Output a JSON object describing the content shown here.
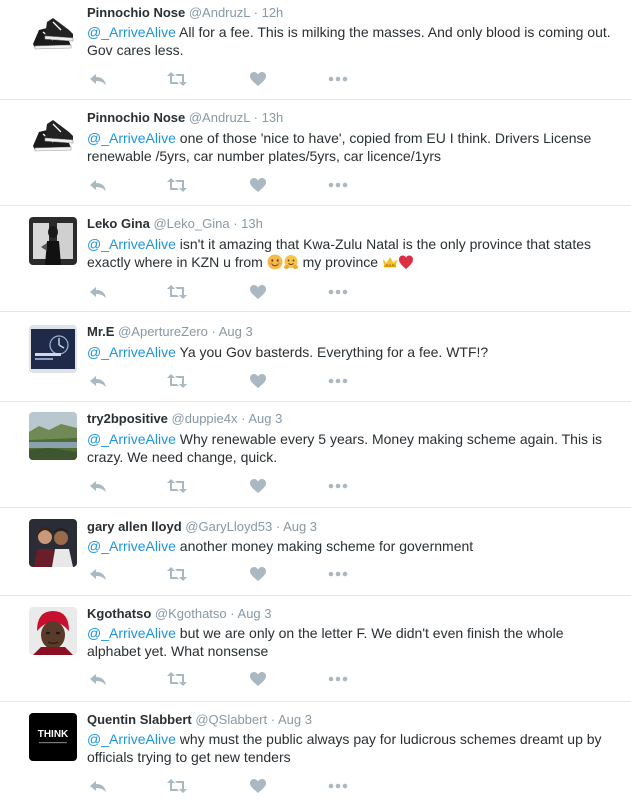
{
  "colors": {
    "mention": "#1b95e0",
    "meta": "#8899a6",
    "icon": "#aab8c2",
    "text": "#292f33",
    "divider": "#e1e8ed",
    "heart": "#e0245e"
  },
  "icons": {
    "reply": "reply-icon",
    "retweet": "retweet-icon",
    "like": "heart-icon",
    "more": "more-dots-icon"
  },
  "tweets": [
    {
      "name": "Pinnochio Nose",
      "handle": "@AndruzL",
      "sep": "·",
      "time": "12h",
      "mention": "@_ArriveAlive",
      "text": " All for a fee. This is milking the masses. And only blood is coming out. Gov cares less.",
      "avatar": "sneakers"
    },
    {
      "name": "Pinnochio Nose",
      "handle": "@AndruzL",
      "sep": "·",
      "time": "13h",
      "mention": "@_ArriveAlive",
      "text": " one of those 'nice to have', copied from EU I think. Drivers License renewable /5yrs, car number plates/5yrs, car licence/1yrs",
      "avatar": "sneakers"
    },
    {
      "name": "Leko Gina",
      "handle": "@Leko_Gina",
      "sep": "·",
      "time": "13h",
      "mention": "@_ArriveAlive",
      "text_a": "  isn't it amazing that Kwa-Zulu Natal is the only province that states exactly where in KZN u from ",
      "text_b": " my province ",
      "emojis_a": [
        "smiling-face-emoji",
        "hugging-face-emoji"
      ],
      "emojis_b": [
        "crown-emoji",
        "red-heart-emoji"
      ],
      "avatar": "dark-portrait"
    },
    {
      "name": "Mr.E",
      "handle": "@ApertureZero",
      "sep": "·",
      "time": "Aug 3",
      "mention": "@_ArriveAlive",
      "text": " Ya you Gov basterds. Everything for a fee. WTF!?",
      "avatar": "clock-logo"
    },
    {
      "name": "try2bpositive",
      "handle": "@duppie4x",
      "sep": "·",
      "time": "Aug 3",
      "mention": "@_ArriveAlive",
      "text": " Why renewable every 5 years. Money making scheme again. This is crazy. We need change, quick.",
      "avatar": "landscape"
    },
    {
      "name": "gary allen lloyd",
      "handle": "@GaryLloyd53",
      "sep": "·",
      "time": "Aug 3",
      "mention": "@_ArriveAlive",
      "text": " another money making scheme for government",
      "avatar": "couple-photo"
    },
    {
      "name": "Kgothatso",
      "handle": "@Kgothatso",
      "sep": "·",
      "time": "Aug 3",
      "mention": "@_ArriveAlive",
      "text": " but we are only on the letter F. We didn't even finish the whole alphabet yet. What nonsense",
      "avatar": "red-headwrap-portrait"
    },
    {
      "name": "Quentin Slabbert",
      "handle": "@QSlabbert",
      "sep": "·",
      "time": "Aug 3",
      "mention": "@_ArriveAlive",
      "text": " why must the public always pay for ludicrous schemes dreamt up by officials trying to get new tenders",
      "avatar": "think-logo",
      "avatar_text": "THINK"
    }
  ]
}
